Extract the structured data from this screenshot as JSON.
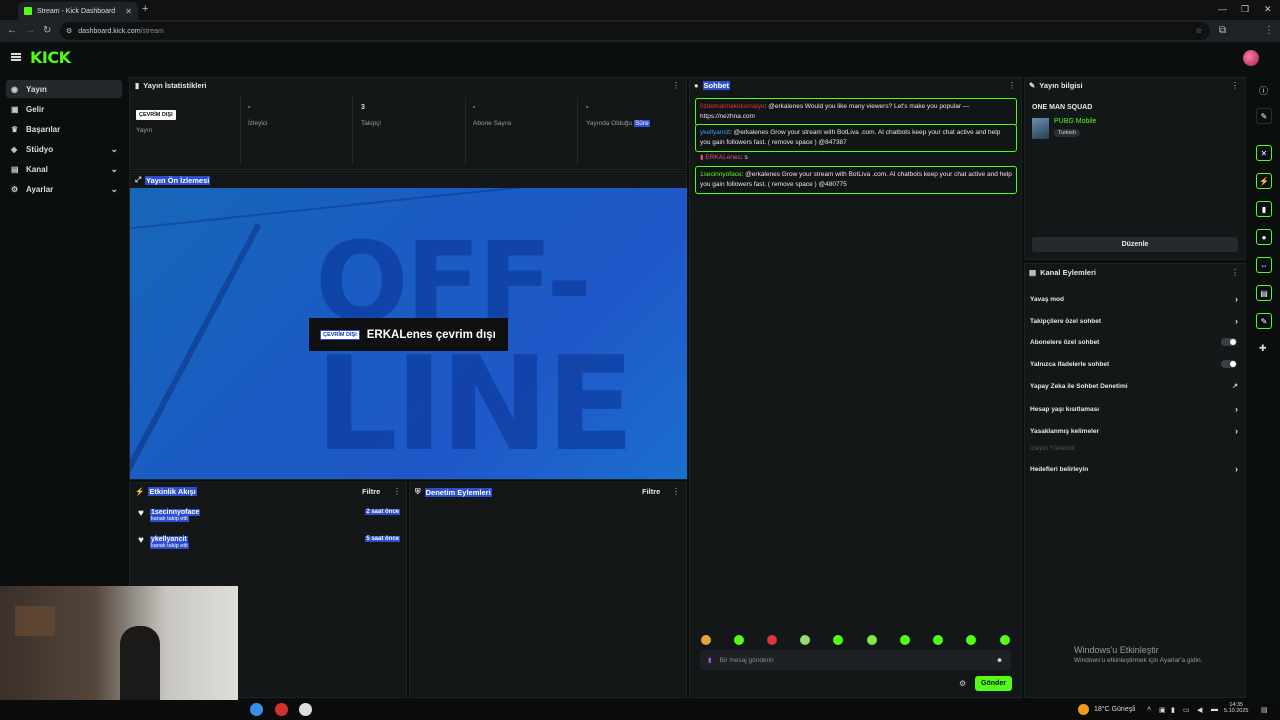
{
  "browser": {
    "tab_title": "Stream - Kick Dashboard",
    "url_host": "dashboard.kick.com",
    "url_path": "/stream"
  },
  "app": {
    "logo": "KICK"
  },
  "sidebar": {
    "items": [
      {
        "label": "Yayın",
        "icon": "broadcast-icon"
      },
      {
        "label": "Gelir",
        "icon": "wallet-icon"
      },
      {
        "label": "Başarılar",
        "icon": "trophy-icon"
      },
      {
        "label": "Stüdyo",
        "icon": "studio-icon"
      },
      {
        "label": "Kanal",
        "icon": "channel-icon"
      },
      {
        "label": "Ayarlar",
        "icon": "gear-icon"
      }
    ]
  },
  "stats": {
    "title": "Yayın İstatistikleri",
    "offline_badge": "ÇEVRİM DIŞI",
    "stream_label": "Yayın",
    "viewers_value": "-",
    "viewers_label": "İzleyici",
    "followers_value": "3",
    "followers_label": "Takipçi",
    "subs_value": "-",
    "subs_label": "Abone Sayısı",
    "uptime_value": "-",
    "uptime_label": "Yayında Olduğu",
    "uptime_label2": "Süre"
  },
  "preview": {
    "title": "Yayın Ön İzlemesi",
    "badge": "ÇEVRİM DIŞI",
    "text": "ERKALenes çevrim dışı",
    "bg_word1": "OFF-",
    "bg_word2": "LINE"
  },
  "activity": {
    "title": "Etkinlik Akışı",
    "filter": "Filtre",
    "items": [
      {
        "name": "1secinnyoface",
        "action": "kanalı takip etti",
        "time": "2 saat önce"
      },
      {
        "name": "ykellyancit",
        "action": "kanalı takip etti",
        "time": "5 saat önce"
      }
    ]
  },
  "moderation": {
    "title": "Denetim Eylemleri",
    "filter": "Filtre"
  },
  "chat": {
    "title": "Sohbet",
    "messages": [
      {
        "user": "0zdemalmakokomalye",
        "text": "@erkalenes Would you like many viewers? Let's make you popular — https://nezhna.com"
      },
      {
        "user": "ykellyancit",
        "text": "@erkalenes Grow your stream with BotLiva .com. AI chatbots keep your chat active and help you gain followers fast. ( remove space ) @847387"
      },
      {
        "user": "ERKALenes",
        "text": "s"
      },
      {
        "user": "1secinnyoface",
        "text": "@erkalenes Grow your stream with BotLiva .com. AI chatbots keep your chat active and help you gain followers fast. ( remove space ) @480775"
      }
    ],
    "input_placeholder": "Bir mesaj gönderin",
    "send_label": "Gönder"
  },
  "stream_info": {
    "title": "Yayın bilgisi",
    "stream_title": "ONE MAN SQUAD",
    "category": "PUBG Mobile",
    "language": "Turkish",
    "edit_label": "Düzenle"
  },
  "channel_actions": {
    "title": "Kanal Eylemleri",
    "items": [
      {
        "label": "Yavaş mod",
        "control": "arrow"
      },
      {
        "label": "Takipçilere özel sohbet",
        "control": "arrow"
      },
      {
        "label": "Abonelere özel sohbet",
        "control": "toggle",
        "on": false
      },
      {
        "label": "Yalnızca ifadelerle sohbet",
        "control": "toggle",
        "on": false
      },
      {
        "label": "Yapay Zeka ile Sohbet Denetimi",
        "control": "external"
      },
      {
        "label": "Hesap yaşı kısıtlaması",
        "control": "arrow"
      },
      {
        "label": "Yasaklanmış kelimeler",
        "control": "arrow"
      }
    ],
    "section_label": "İzleyici Yönlendir",
    "target_label": "Hedefleri belirleyin"
  },
  "watermark": {
    "line1": "Windows'u Etkinleştir",
    "line2": "Windows'u etkinleştirmek için Ayarlar'a gidin."
  },
  "taskbar": {
    "weather": "18°C  Güneşli",
    "time": "14:35",
    "date": "5.10.2025"
  },
  "colors": {
    "brand": "#53fc18",
    "highlight": "#2d4ecf",
    "bg": "#0b0e0f",
    "panel": "#141718"
  }
}
